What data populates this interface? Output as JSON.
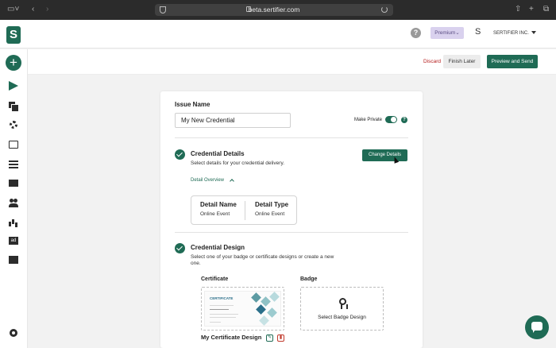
{
  "browser": {
    "url": "beta.sertifier.com"
  },
  "topbar": {
    "logo_letter": "S",
    "help": "?",
    "plan": "Premium",
    "avatar_letter": "S",
    "company": "SERTIFIER INC."
  },
  "actions": {
    "discard": "Discard",
    "finish_later": "Finish Later",
    "preview_send": "Preview and Send"
  },
  "sidebar": {
    "add": "+",
    "items": [
      {
        "icon": "send-icon"
      },
      {
        "icon": "copy-icon"
      },
      {
        "icon": "gear-icon"
      },
      {
        "icon": "screen-icon"
      },
      {
        "icon": "list-icon"
      },
      {
        "icon": "mail-icon"
      },
      {
        "icon": "users-icon"
      },
      {
        "icon": "chart-icon"
      },
      {
        "icon": "ad-icon",
        "label": "ad"
      },
      {
        "icon": "gift-icon"
      },
      {
        "icon": "settings-icon"
      }
    ]
  },
  "form": {
    "issue_name_label": "Issue Name",
    "issue_name_value": "My New Credential",
    "make_private_label": "Make Private",
    "make_private_on": true,
    "info": "?",
    "credential_details": {
      "title": "Credential Details",
      "subtitle": "Select details for your credential delivery.",
      "change_button": "Change Details",
      "overview_toggle": "Detail Overview",
      "detail_name_header": "Detail Name",
      "detail_name_value": "Online Event",
      "detail_type_header": "Detail Type",
      "detail_type_value": "Online Event"
    },
    "credential_design": {
      "title": "Credential Design",
      "subtitle": "Select one of your badge or certificate designs or create a new one.",
      "certificate_label": "Certificate",
      "badge_label": "Badge",
      "select_badge": "Select Badge Design",
      "certificate_name": "My Certificate Design",
      "thumb_heading": "CERTIFICATE"
    }
  },
  "colors": {
    "accent": "#1f6b55",
    "discard": "#b51c1c",
    "premium_bg": "#d9d1ee"
  }
}
